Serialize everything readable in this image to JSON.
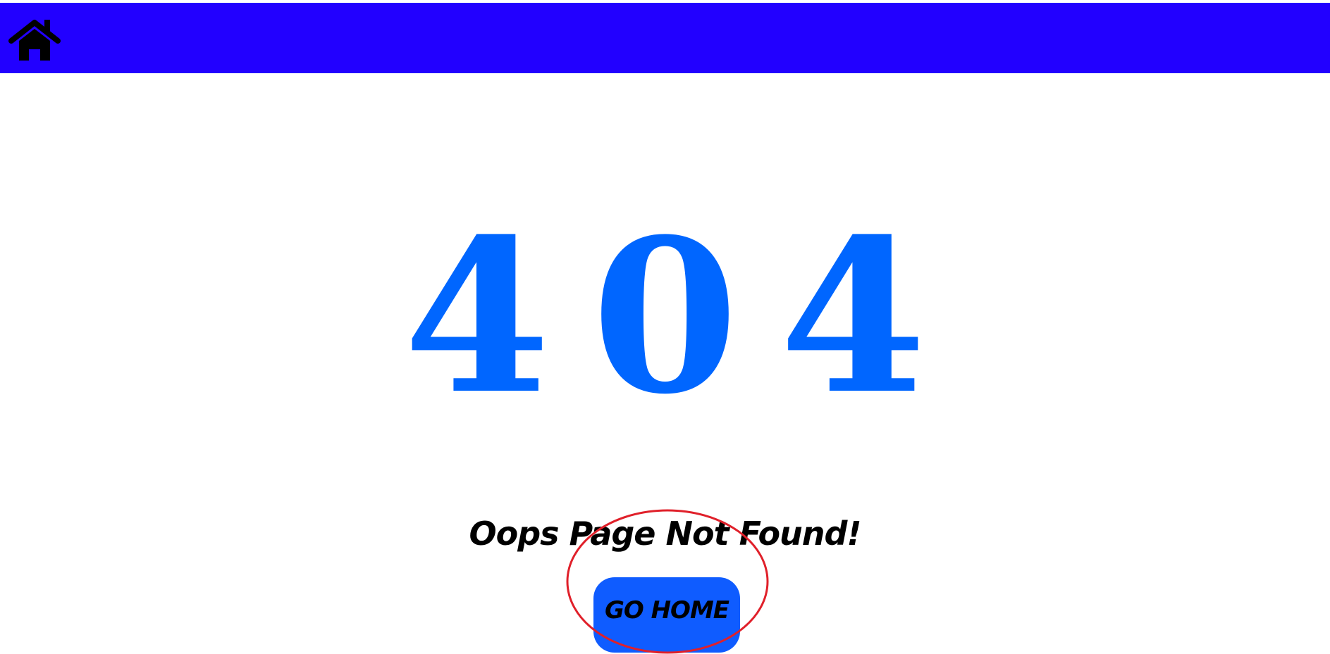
{
  "navbar": {
    "background_color": "#2200ff",
    "home_icon": "home-icon"
  },
  "error": {
    "code": "404",
    "color": "#0066ff"
  },
  "message": {
    "text": "Oops Page Not Found!"
  },
  "go_home_button": {
    "label": "GO HOME",
    "background_color": "#0f5cff"
  },
  "annotation": {
    "shape": "ellipse",
    "color": "#e0202a"
  }
}
